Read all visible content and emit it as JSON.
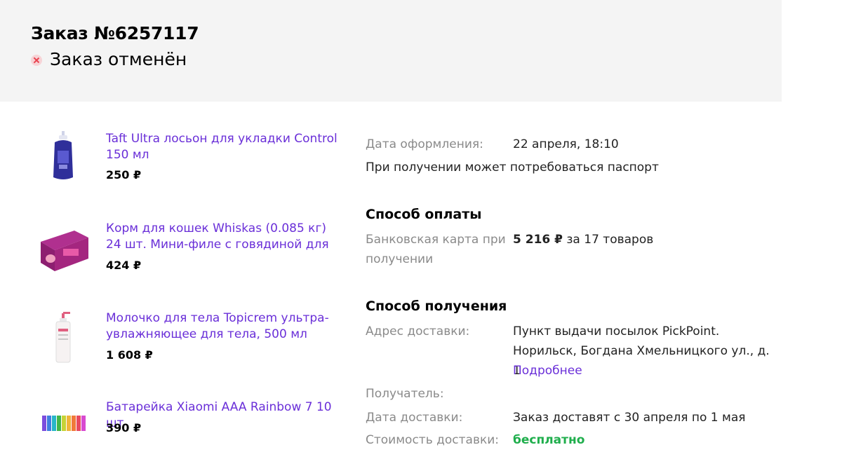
{
  "order": {
    "title": "Заказ №6257117",
    "status": "Заказ отменён"
  },
  "products": [
    {
      "name": "Taft Ultra лосьон для укладки Control 150 мл",
      "price": "250 ₽"
    },
    {
      "name": "Корм для кошек Whiskas (0.085 кг) 24 шт. Мини-филе с говядиной для",
      "price": "424 ₽"
    },
    {
      "name": "Молочко для тела Topicrem ультра-увлажняющее для тела, 500 мл",
      "price": "1 608 ₽"
    },
    {
      "name": "Батарейка Xiaomi AAA Rainbow 7 10 шт",
      "price": "390 ₽"
    }
  ],
  "details": {
    "order_date_label": "Дата оформления:",
    "order_date_value": "22 апреля, 18:10",
    "passport_note": "При получении может потребоваться паспорт",
    "payment": {
      "title": "Способ оплаты",
      "method_label": "Банковская карта при получении",
      "amount": "5 216 ₽",
      "amount_suffix": "за 17 товаров"
    },
    "delivery": {
      "title": "Способ получения",
      "address_label": "Адрес доставки:",
      "address_value": "Пункт выдачи посылок PickPoint. Норильск, Богдана Хмельницкого ул., д. 1",
      "more_link": "Подробнее",
      "recipient_label": "Получатель:",
      "date_label": "Дата доставки:",
      "date_value": "Заказ доставят с 30 апреля по 1 мая",
      "cost_label": "Стоимость доставки:",
      "cost_value": "бесплатно"
    }
  },
  "colors": {
    "link": "#6a2fd8",
    "header_bg": "#f4f4f4",
    "cancel_icon": "#e8424f",
    "free": "#1fae4c"
  }
}
